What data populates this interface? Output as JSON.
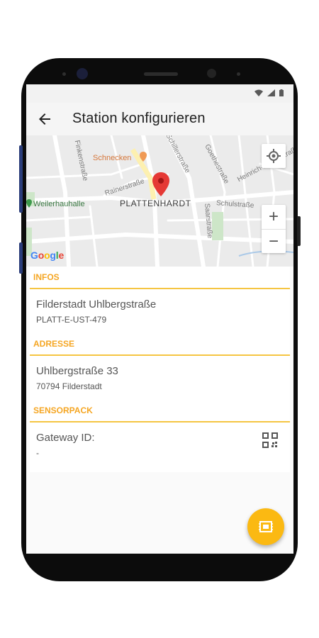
{
  "app": {
    "title": "Station konfigurieren"
  },
  "map": {
    "city": "PLATTENHARDT",
    "poi": "Schnecken",
    "poi2": "Weilerhauhalle",
    "google": "Google",
    "streets": [
      "Finkenstraße",
      "Schillerstraße",
      "Goethestraße",
      "Heinrich-Hertz-Straße",
      "Rainerstraße",
      "Schulstraße",
      "Saarstraße"
    ],
    "zoom_in": "+",
    "zoom_out": "−"
  },
  "infos": {
    "title": "INFOS",
    "name": "Filderstadt Uhlbergstraße",
    "id": "PLATT-E-UST-479"
  },
  "adresse": {
    "title": "ADRESSE",
    "street": "Uhlbergstraße 33",
    "city": "70794 Filderstadt"
  },
  "sensorpack": {
    "title": "SENSORPACK",
    "label": "Gateway ID:",
    "value": "-"
  },
  "colors": {
    "accent": "#f5a623",
    "fab": "#fbb912",
    "pin": "#e53935"
  }
}
